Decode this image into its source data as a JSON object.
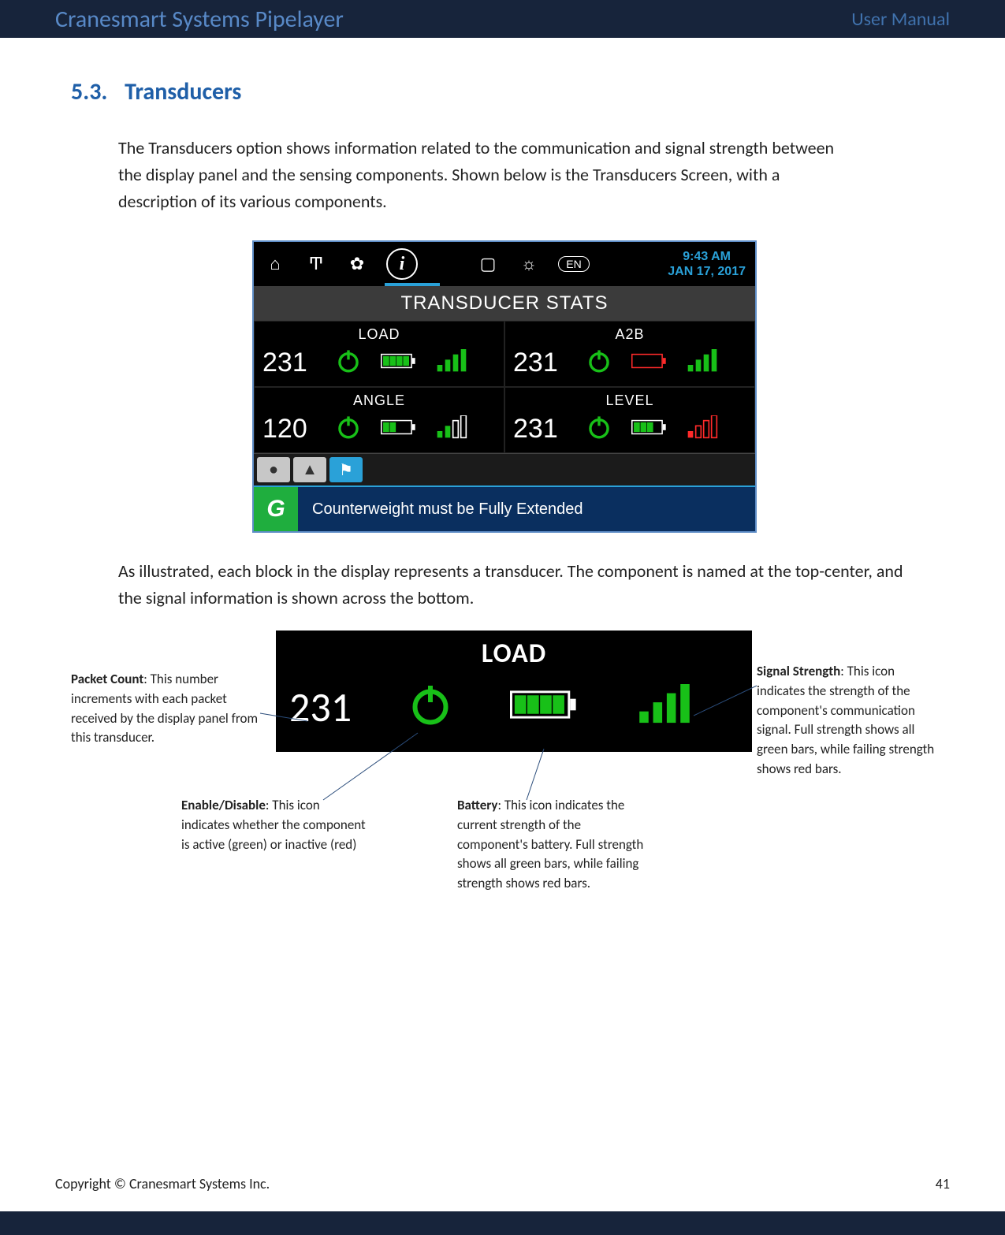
{
  "header": {
    "product": "Cranesmart Systems Pipelayer",
    "doc_type": "User Manual"
  },
  "section": {
    "number": "5.3.",
    "title": "Transducers"
  },
  "paragraph1": "The Transducers option shows information related to the communication and signal strength between the display panel and the sensing components.  Shown below is the Transducers Screen, with a description of its various components.",
  "device": {
    "time": "9:43 AM",
    "date": "JAN 17, 2017",
    "band_title": "TRANSDUCER STATS",
    "cells": {
      "load": {
        "label": "LOAD",
        "value": "231",
        "battery_level": 4,
        "battery_color": "#18c018",
        "signal_bars": [
          1,
          1,
          1,
          1
        ],
        "signal_color": "#18c018"
      },
      "a2b": {
        "label": "A2B",
        "value": "231",
        "battery_level": 0,
        "battery_color": "#ff2a2a",
        "signal_bars": [
          1,
          1,
          1,
          1
        ],
        "signal_color": "#18c018"
      },
      "angle": {
        "label": "ANGLE",
        "value": "120",
        "battery_level": 2,
        "battery_color": "#18c018",
        "signal_bars": [
          1,
          1,
          0,
          0
        ],
        "signal_color_low": "#18c018",
        "signal_color_empty": "#ffffff"
      },
      "level": {
        "label": "LEVEL",
        "value": "231",
        "battery_level": 3,
        "battery_color": "#18c018",
        "signal_bars": [
          1,
          0,
          0,
          0
        ],
        "signal_color_low": "#ff2a2a",
        "signal_color_empty": "#ff2a2a"
      }
    },
    "message": "Counterweight must be Fully Extended"
  },
  "paragraph2": "As illustrated, each block in the display represents a transducer.  The component is named at the top-center, and the signal information is shown across the bottom.",
  "detail": {
    "label": "LOAD",
    "value": "231"
  },
  "annotations": {
    "packet_count": {
      "title": "Packet Count",
      "body": ":  This number increments with each packet received by the display panel from this transducer."
    },
    "enable": {
      "title": "Enable/Disable",
      "body": ":  This icon indicates whether the component is active (green) or inactive (red)"
    },
    "battery": {
      "title": "Battery",
      "body": ":  This icon indicates the current strength of the component's battery.  Full strength shows all green bars, while failing strength shows red bars."
    },
    "signal": {
      "title": "Signal Strength",
      "body": ":  This icon indicates the strength of the component's communication signal.  Full strength shows all green bars, while failing strength shows red bars."
    }
  },
  "footer": {
    "copyright": "Copyright © Cranesmart Systems Inc.",
    "page_no": "41"
  }
}
